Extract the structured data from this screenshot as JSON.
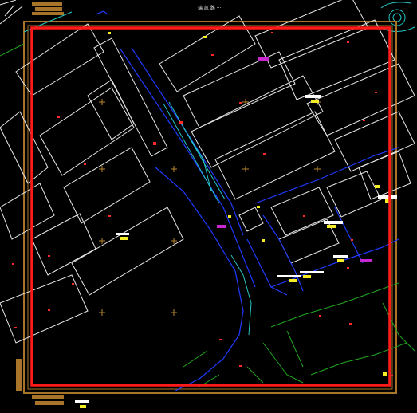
{
  "viewer": {
    "background": "#000000",
    "top_label": "瑞 凯 路 ···"
  },
  "colors": {
    "frame_outer": "#a8742a",
    "frame_red": "#ff1a1a",
    "buildings": "#e8e8e8",
    "blue_road": "#1f3bff",
    "cyan_line": "#24c6c6",
    "green_line": "#20a820",
    "red_marker": "#ff2a2a",
    "yellow_label": "#f4ec25",
    "white_label": "#ffffff",
    "magenta_label": "#c928d1",
    "cross_marker": "#b8862b"
  },
  "legend_icons": {
    "top_left_block": "brown-title-block-icon",
    "bottom_left_block": "brown-title-block-icon",
    "top_right_block": "cyan-roundabout-icon"
  }
}
